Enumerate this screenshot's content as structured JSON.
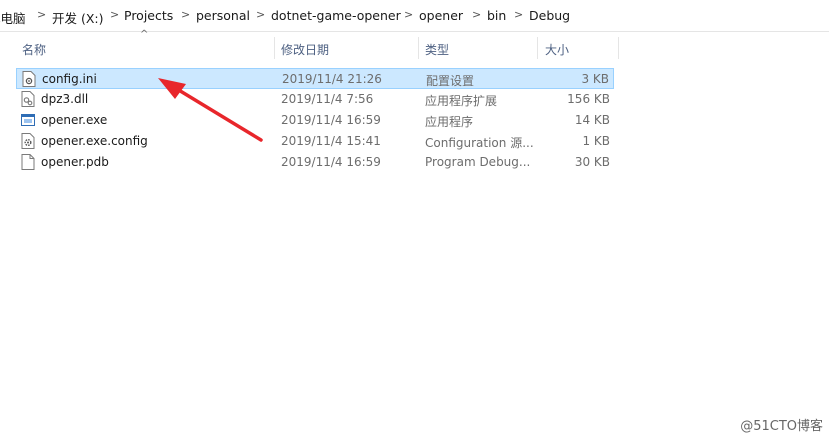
{
  "address": {
    "crumbs": [
      "此电脑",
      "开发 (X:)",
      "Projects",
      "personal",
      "dotnet-game-opener",
      "opener",
      "bin",
      "Debug"
    ],
    "separator": ">"
  },
  "columns": {
    "name": "名称",
    "date": "修改日期",
    "type": "类型",
    "size": "大小",
    "sort_indicator": "^"
  },
  "files": [
    {
      "name": "config.ini",
      "date": "2019/11/4 21:26",
      "type": "配置设置",
      "size": "3 KB",
      "icon": "ini-file-icon",
      "selected": true
    },
    {
      "name": "dpz3.dll",
      "date": "2019/11/4 7:56",
      "type": "应用程序扩展",
      "size": "156 KB",
      "icon": "dll-file-icon",
      "selected": false
    },
    {
      "name": "opener.exe",
      "date": "2019/11/4 16:59",
      "type": "应用程序",
      "size": "14 KB",
      "icon": "exe-file-icon",
      "selected": false
    },
    {
      "name": "opener.exe.config",
      "date": "2019/11/4 15:41",
      "type": "Configuration 源...",
      "size": "1 KB",
      "icon": "config-file-icon",
      "selected": false
    },
    {
      "name": "opener.pdb",
      "date": "2019/11/4 16:59",
      "type": "Program Debug...",
      "size": "30 KB",
      "icon": "pdb-file-icon",
      "selected": false
    }
  ],
  "annotation": {
    "color": "#e8262b"
  },
  "watermark": "@51CTO博客",
  "colors": {
    "selection": "#cce8ff",
    "selection_border": "#99d1ff",
    "header_text": "#4d6082"
  }
}
